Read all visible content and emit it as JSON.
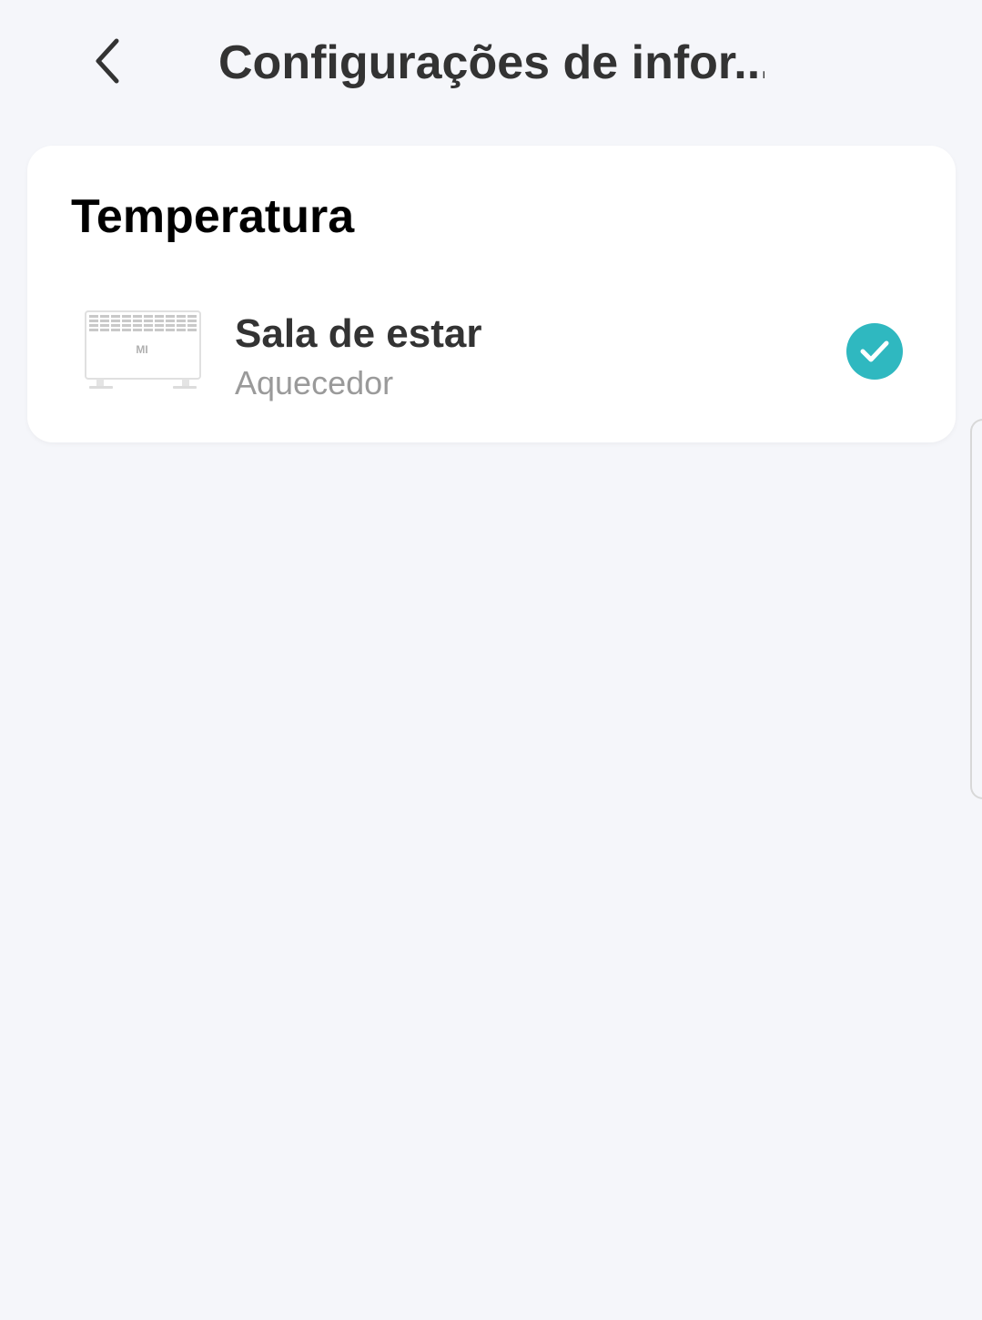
{
  "header": {
    "title": "Configurações de infor...",
    "back_icon": "chevron-left-icon"
  },
  "card": {
    "section_title": "Temperatura",
    "device": {
      "name": "Sala de estar",
      "type": "Aquecedor",
      "image_icon": "heater-device-image",
      "brand_logo": "MI",
      "selected": true,
      "check_icon": "check-circle-icon",
      "accent_color": "#2fb8c0"
    }
  },
  "colors": {
    "background": "#f5f6fa",
    "card": "#ffffff",
    "title_text": "#333333",
    "secondary_text": "#9a9a9a"
  }
}
